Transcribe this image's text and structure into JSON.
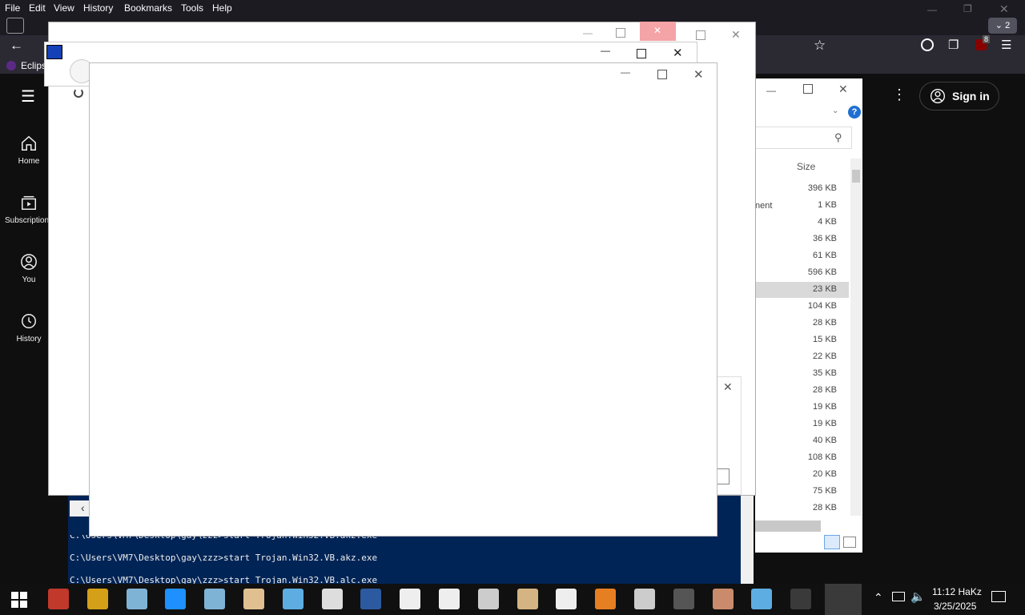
{
  "firefox": {
    "menu": [
      "File",
      "Edit",
      "View",
      "History",
      "Bookmarks",
      "Tools",
      "Help"
    ],
    "bookmark_label": "Eclips",
    "tab_count": "2",
    "ublock_badge": "8"
  },
  "youtube": {
    "nav": [
      {
        "label": "Home",
        "icon": "home-icon"
      },
      {
        "label": "Subscriptions",
        "icon": "subscriptions-icon"
      },
      {
        "label": "You",
        "icon": "you-icon"
      },
      {
        "label": "History",
        "icon": "history-icon"
      }
    ],
    "sign_in": "Sign in"
  },
  "explorer": {
    "col_header": "Size",
    "partial_name": "nent",
    "sizes": [
      "396 KB",
      "1 KB",
      "4 KB",
      "36 KB",
      "61 KB",
      "596 KB",
      "23 KB",
      "104 KB",
      "28 KB",
      "15 KB",
      "22 KB",
      "35 KB",
      "28 KB",
      "19 KB",
      "19 KB",
      "40 KB",
      "108 KB",
      "20 KB",
      "75 KB",
      "28 KB"
    ],
    "selected_index": 6
  },
  "console": {
    "lines": [
      "C:\\Users\\VM7\\Desktop\\gay\\zzz>start Trojan.Win32.VB.akz.exe",
      "C:\\Users\\VM7\\Desktop\\gay\\zzz>start Trojan.Win32.VB.alc.exe"
    ]
  },
  "tray": {
    "time": "11:12 HaKz",
    "date": "3/25/2025"
  },
  "taskbar_icons": [
    "start-icon",
    "winrar-icon",
    "explorer-folder-icon",
    "notepad-icon",
    "internet-explorer-icon",
    "notepad2-icon",
    "paint-icon",
    "control-panel-icon",
    "settings-icon",
    "powershell-icon",
    "folder-icon",
    "folder2-icon",
    "window-icon",
    "calculator-icon",
    "folder3-icon",
    "game-icon",
    "window2-icon",
    "mc-icon",
    "character-icon",
    "computer-icon",
    "blank-app-icon"
  ]
}
